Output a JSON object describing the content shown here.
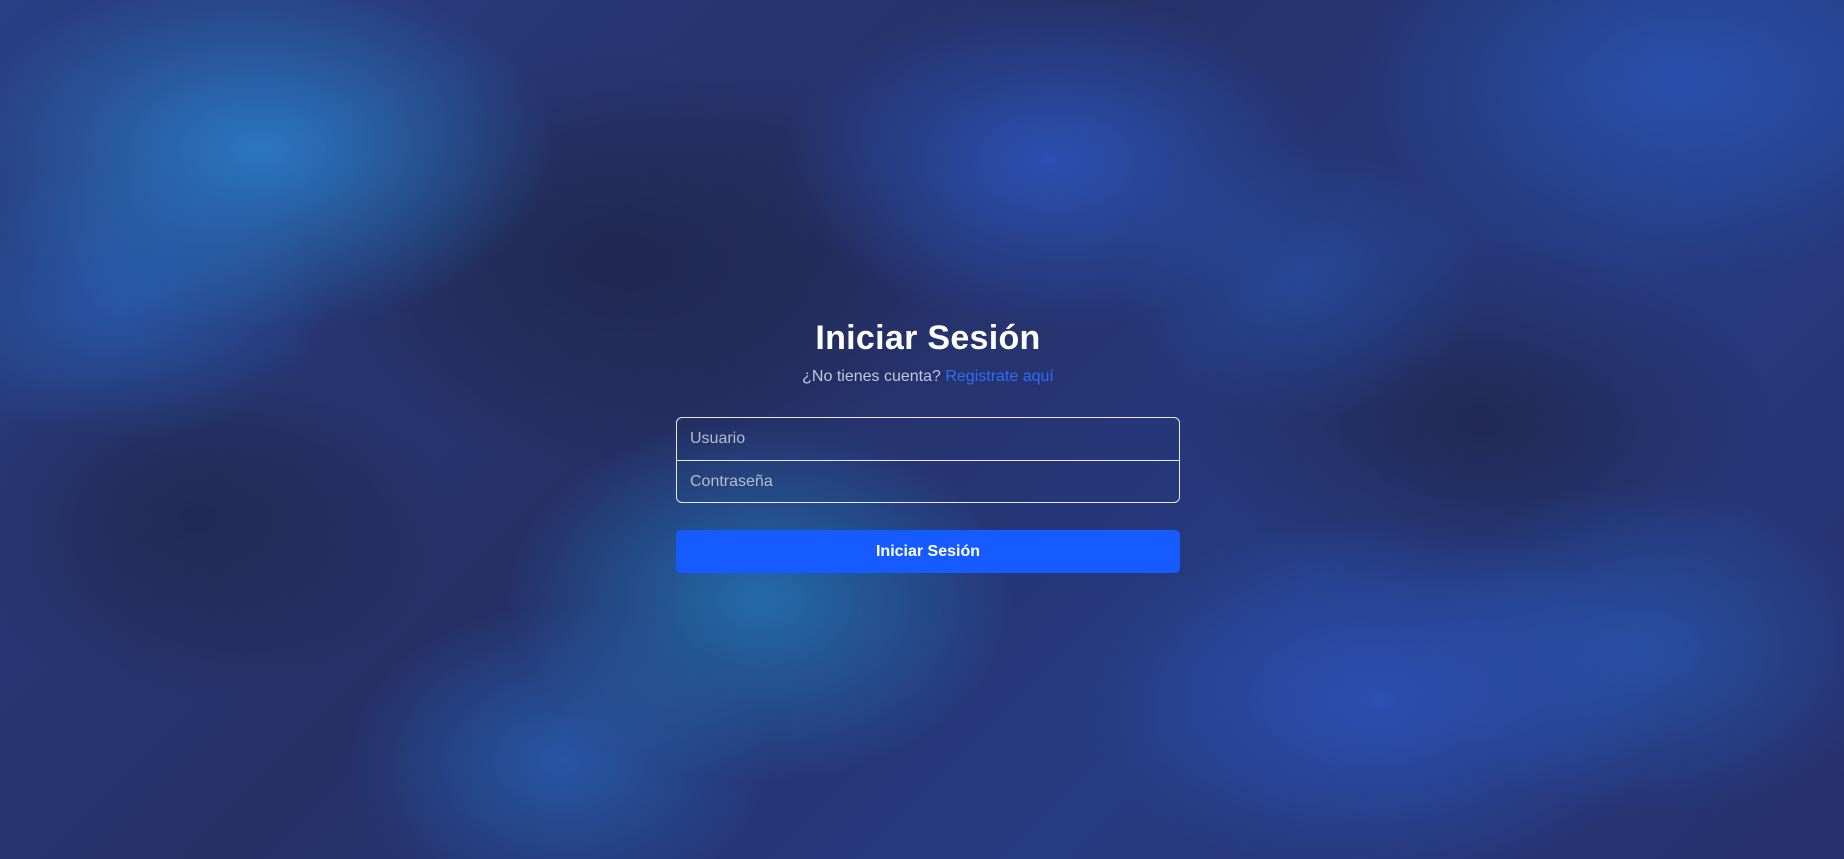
{
  "login": {
    "title": "Iniciar Sesión",
    "subtitle_text": "¿No tienes cuenta?",
    "register_link": "Registrate aquí",
    "username_placeholder": "Usuario",
    "username_value": "",
    "password_placeholder": "Contraseña",
    "password_value": "",
    "submit_label": "Iniciar Sesión"
  },
  "colors": {
    "accent": "#165bff",
    "link": "#2e6df6",
    "background": "#25305e"
  }
}
